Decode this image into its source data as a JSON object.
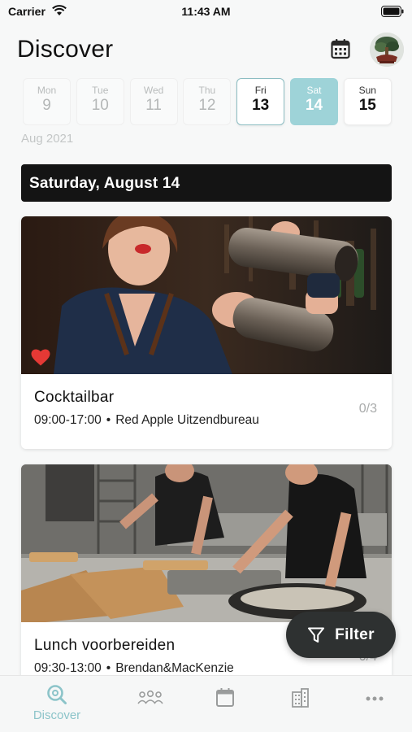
{
  "status": {
    "carrier": "Carrier",
    "time": "11:43 AM"
  },
  "header": {
    "title": "Discover"
  },
  "days": [
    {
      "name": "Mon",
      "num": "9",
      "state": "past"
    },
    {
      "name": "Tue",
      "num": "10",
      "state": "past"
    },
    {
      "name": "Wed",
      "num": "11",
      "state": "past"
    },
    {
      "name": "Thu",
      "num": "12",
      "state": "past"
    },
    {
      "name": "Fri",
      "num": "13",
      "state": "today"
    },
    {
      "name": "Sat",
      "num": "14",
      "state": "selected"
    },
    {
      "name": "Sun",
      "num": "15",
      "state": "normal"
    }
  ],
  "month_label": "Aug 2021",
  "date_banner": "Saturday, August 14",
  "cards": [
    {
      "title": "Cocktailbar",
      "time": "09:00-17:00",
      "company": "Red Apple Uitzendbureau",
      "count": "0/3",
      "favorited": true
    },
    {
      "title": "Lunch voorbereiden",
      "time": "09:30-13:00",
      "company": "Brendan&MacKenzie",
      "count": "0/4",
      "favorited": false
    }
  ],
  "filter": {
    "label": "Filter"
  },
  "tabs": [
    {
      "label": "Discover",
      "icon": "search-icon",
      "active": true
    },
    {
      "label": "",
      "icon": "people-icon"
    },
    {
      "label": "",
      "icon": "calendar-icon"
    },
    {
      "label": "",
      "icon": "building-icon"
    },
    {
      "label": "",
      "icon": "more-icon"
    }
  ],
  "colors": {
    "accent": "#8cc4c9",
    "selected_day": "#9ed3d8",
    "banner": "#141414",
    "filter_button": "#2e3131",
    "heart": "#e53935"
  }
}
